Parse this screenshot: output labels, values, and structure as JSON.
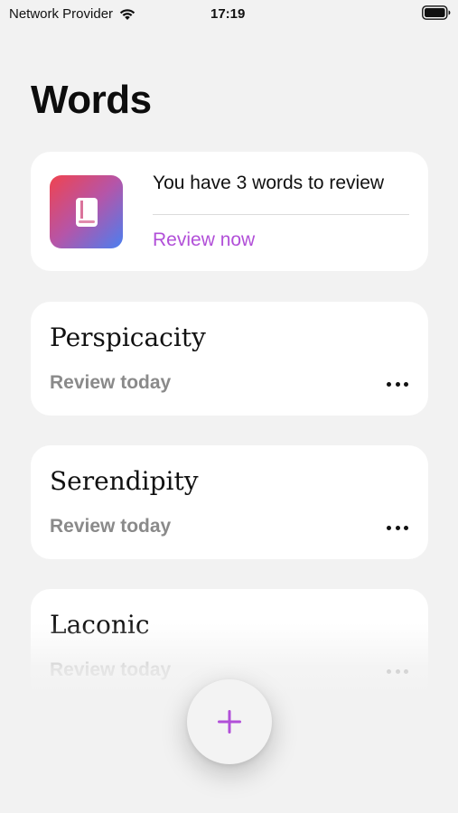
{
  "status_bar": {
    "carrier": "Network Provider",
    "time": "17:19",
    "wifi_icon": "wifi-icon",
    "battery_icon": "battery-icon"
  },
  "page": {
    "title": "Words"
  },
  "review_card": {
    "icon": "book-icon",
    "message": "You have 3 words to review",
    "action": "Review now",
    "accent_color": "#b14fd8"
  },
  "words": [
    {
      "word": "Perspicacity",
      "status": "Review today",
      "more_icon": "more-icon"
    },
    {
      "word": "Serendipity",
      "status": "Review today",
      "more_icon": "more-icon"
    },
    {
      "word": "Laconic",
      "status": "Review today",
      "more_icon": "more-icon"
    }
  ],
  "fab": {
    "icon": "plus-icon",
    "color": "#b14fd8"
  }
}
